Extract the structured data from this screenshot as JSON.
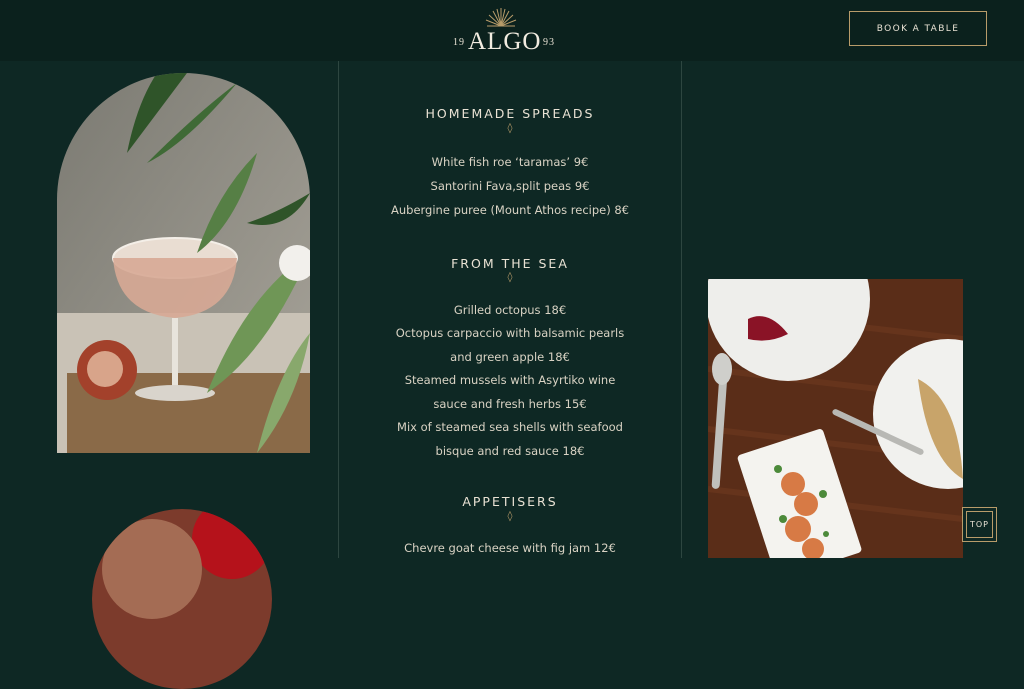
{
  "header": {
    "logo": {
      "year_left": "19",
      "name": "ALGO",
      "year_right": "93"
    },
    "book_button": "BOOK A TABLE"
  },
  "menu": {
    "sections": [
      {
        "title": "HOMEMADE SPREADS",
        "items": [
          "White fish roe ‘taramas’ 9€",
          "Santorini Fava,split peas 9€",
          "Aubergine puree (Mount Athos recipe) 8€"
        ]
      },
      {
        "title": "FROM THE SEA",
        "items": [
          "Grilled octopus 18€",
          "Octopus carpaccio with balsamic pearls",
          "and green apple 18€",
          "Steamed mussels with Asyrtiko wine",
          "sauce and fresh herbs 15€",
          "Mix of steamed sea shells with seafood",
          "bisque and red sauce 18€"
        ]
      },
      {
        "title": "APPETISERS",
        "items": [
          "Chevre goat cheese with fig jam 12€"
        ]
      }
    ],
    "divider_glyph": "◊"
  },
  "top_button": "TOP",
  "colors": {
    "background": "#0e2824",
    "header": "#0b211d",
    "accent_gold": "#b89c6a",
    "text": "#e9e2d4"
  }
}
